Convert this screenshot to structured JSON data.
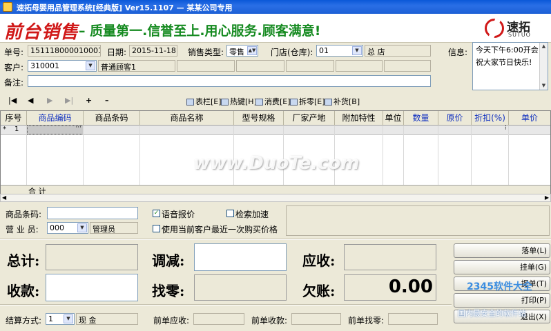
{
  "window": {
    "title": "速拓母婴用品管理系统[经典版] Ver15.1107 — 某某公司专用"
  },
  "banner": {
    "logo_text": "前台销售",
    "slogan": "– 质量第一.信誉至上.用心服务.顾客满意!",
    "brand_cn": "速拓",
    "brand_en": "SUTUO"
  },
  "form": {
    "order_no_label": "单号:",
    "order_no": "151118000010001",
    "date_label": "日期:",
    "date": "2015-11-18",
    "sale_type_label": "销售类型:",
    "sale_type": "零售",
    "store_label": "门店(仓库):",
    "store_code": "01",
    "store_name": "总  店",
    "info_label": "信息:",
    "info_text": "今天下午6:00开会 祝大家节日快乐!",
    "customer_label": "客户:",
    "customer_code": "310001",
    "customer_name": "普通顾客1",
    "remark_label": "备注:"
  },
  "toolbar": {
    "nav": [
      "|◀",
      "◀",
      "▶",
      "▶|",
      "+",
      "–"
    ],
    "buttons": [
      "表栏[E]",
      "热键[H]",
      "消费[E]",
      "拆零[E]",
      "补货[B]"
    ]
  },
  "grid": {
    "columns": [
      "序号",
      "商品编码",
      "商品条码",
      "商品名称",
      "型号规格",
      "厂家产地",
      "附加特性",
      "单位",
      "数量",
      "原价",
      "折扣(%)",
      "单价"
    ],
    "rows": [
      {
        "marker": "*",
        "no": "1"
      }
    ],
    "total_label": "合  计"
  },
  "lower": {
    "barcode_label": "商品条码:",
    "barcode_value": "",
    "voice_label": "语音报价",
    "search_speed_label": "检索加速",
    "use_last_price_label": "使用当前客户最近一次购买价格",
    "clerk_label": "营 业 员:",
    "clerk_code": "000",
    "clerk_name": "管理员"
  },
  "summary": {
    "total_label": "总计:",
    "adjust_label": "调减:",
    "receivable_label": "应收:",
    "received_label": "收款:",
    "change_label": "找零:",
    "owed_label": "欠账:",
    "owed_value": "0.00"
  },
  "actions": [
    "落单(L)",
    "挂单(G)",
    "提单(T)",
    "打印(P)",
    "退出(X)"
  ],
  "footer": {
    "payment_label": "结算方式:",
    "payment_code": "1",
    "payment_name": "现  金",
    "prev_receivable_label": "前单应收:",
    "prev_received_label": "前单收款:",
    "prev_change_label": "前单找零:"
  },
  "watermarks": {
    "duote": "www.DuoTe.com",
    "site2345": "2345软件大全",
    "safe": "国内最安全的软件站"
  }
}
